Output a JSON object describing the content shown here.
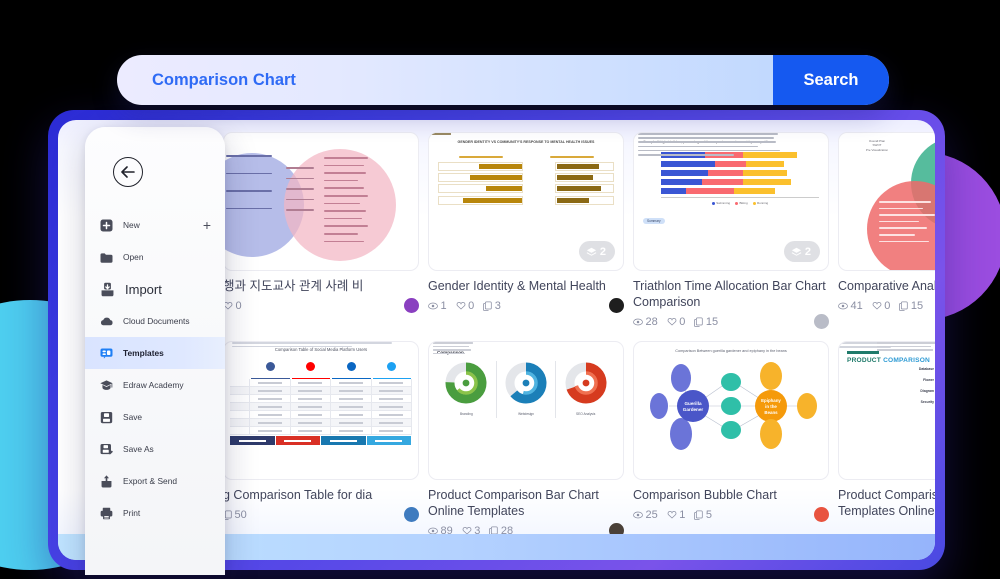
{
  "search": {
    "value": "Comparison Chart",
    "placeholder": "Comparison Chart",
    "button_label": "Search",
    "accent": "#1559f0"
  },
  "sidebar": {
    "back_icon": "back-arrow-icon",
    "new_plus_label": "+",
    "items": [
      {
        "label": "New",
        "icon": "new-file-icon",
        "active": false,
        "size": "sm",
        "trailing": "+"
      },
      {
        "label": "Open",
        "icon": "folder-icon",
        "active": false,
        "size": "sm"
      },
      {
        "label": "Import",
        "icon": "import-icon",
        "active": false,
        "size": "lg"
      },
      {
        "label": "Cloud Documents",
        "icon": "cloud-icon",
        "active": false,
        "size": "sm"
      },
      {
        "label": "Templates",
        "icon": "templates-icon",
        "active": true,
        "size": "sm"
      },
      {
        "label": "Edraw Academy",
        "icon": "graduation-cap-icon",
        "active": false,
        "size": "sm"
      },
      {
        "label": "Save",
        "icon": "save-icon",
        "active": false,
        "size": "sm"
      },
      {
        "label": "Save As",
        "icon": "save-as-icon",
        "active": false,
        "size": "sm"
      },
      {
        "label": "Export & Send",
        "icon": "export-send-icon",
        "active": false,
        "size": "sm"
      },
      {
        "label": "Print",
        "icon": "printer-icon",
        "active": false,
        "size": "sm"
      }
    ]
  },
  "cards": [
    {
      "title": "행과 지도교사 관계 사례 비",
      "views": "",
      "likes": "0",
      "copies": "",
      "avatar_color": "#8a3fc0",
      "pages": "",
      "thumb": "venn-korean"
    },
    {
      "title": "Gender Identity & Mental Health",
      "views": "1",
      "likes": "0",
      "copies": "3",
      "avatar_color": "#1e1e1e",
      "pages": "2",
      "thumb": "bar-gold"
    },
    {
      "title": "Triathlon Time Allocation Bar Chart Comparison",
      "views": "28",
      "likes": "0",
      "copies": "15",
      "avatar_color": "#b9bcc7",
      "pages": "2",
      "thumb": "stacked-bar"
    },
    {
      "title": "Comparative Analysis of Capture",
      "views": "41",
      "likes": "0",
      "copies": "15",
      "avatar_color": "#c9ccd6",
      "pages": "",
      "thumb": "venn3"
    },
    {
      "title": "g Comparison Table for dia",
      "views": "",
      "likes": "",
      "copies": "50",
      "avatar_color": "#3f7bbf",
      "pages": "",
      "thumb": "social-table"
    },
    {
      "title": "Product Comparison Bar Chart Online Templates",
      "views": "89",
      "likes": "3",
      "copies": "28",
      "avatar_color": "#4a4038",
      "pages": "",
      "thumb": "three-donuts"
    },
    {
      "title": "Comparison Bubble Chart",
      "views": "25",
      "likes": "1",
      "copies": "5",
      "avatar_color": "#e8533f",
      "pages": "",
      "thumb": "bubble"
    },
    {
      "title": "Product Comparison Chart Templates Online",
      "views": "",
      "likes": "",
      "copies": "",
      "avatar_color": "#cfd2da",
      "pages": "",
      "thumb": "pie-infographic"
    }
  ],
  "thumb_text": {
    "gender_title": "GENDER IDENTITY VS COMMUNITY'S RESPONSE TO MENTAL HEALTH ISSUES",
    "triathlon_title": "Campbell high triathlon, percentage of time spent on each event by competition",
    "triathlon_legend": [
      "Swimming",
      "Biking",
      "Running"
    ],
    "triathlon_summary_tag": "Summary",
    "bubble_title": "Comparison Between guerilla gardener and epiphany in the beans",
    "bubble_left_hub": "Guerilla Gardener",
    "bubble_right_hub": "Epiphany in the Beans",
    "donut_title": "Comparison",
    "donut_labels": [
      "Branding",
      "Webdesign",
      "SEO Analysis"
    ],
    "social_table_title": "Comparison Table of Social Media Platform Users",
    "social_columns": [
      "Facebook",
      "YouTube",
      "LinkedIn",
      "Twitter"
    ],
    "pie_title_1": "PRODUCT",
    "pie_title_2": "COMPARISON",
    "pie_labels": [
      "Database",
      "Flower",
      "Diagram",
      "Security"
    ]
  },
  "colors": {
    "search_text": "#2f6bf5",
    "search_button_bg": "#1559f0",
    "frame_indigo": "#2b2bd4",
    "blob_cyan": "#4ECFF0",
    "blob_purple": "#9B4DE0",
    "active_item_bg": "#d9e4ff"
  }
}
